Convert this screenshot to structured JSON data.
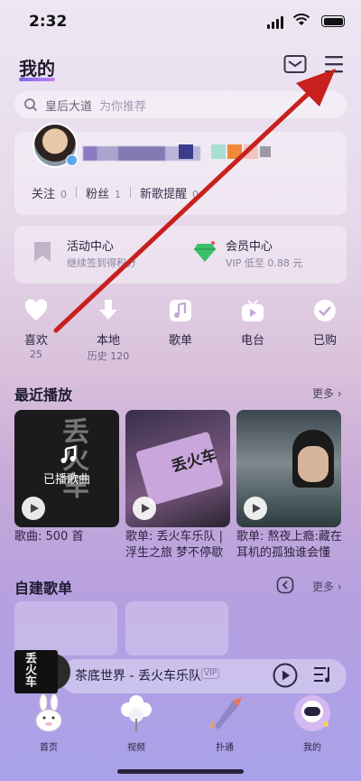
{
  "status": {
    "time": "2:32"
  },
  "header": {
    "title": "我的"
  },
  "search": {
    "query": "皇后大道",
    "hint": "为你推荐"
  },
  "profile": {
    "stats": [
      {
        "label": "关注",
        "value": "0"
      },
      {
        "label": "粉丝",
        "value": "1"
      },
      {
        "label": "新歌提醒",
        "value": "0"
      }
    ]
  },
  "activities": [
    {
      "title": "活动中心",
      "subtitle": "继续签到得积分"
    },
    {
      "title": "会员中心",
      "subtitle": "VIP 低至 0.88 元"
    }
  ],
  "quick": [
    {
      "label": "喜欢",
      "sub": "25",
      "icon": "heart-icon"
    },
    {
      "label": "本地",
      "sub": "历史 120",
      "icon": "download-icon"
    },
    {
      "label": "歌单",
      "sub": "",
      "icon": "music-note-icon"
    },
    {
      "label": "电台",
      "sub": "",
      "icon": "radio-icon"
    },
    {
      "label": "已购",
      "sub": "",
      "icon": "check-icon"
    }
  ],
  "recent": {
    "title": "最近播放",
    "more": "更多",
    "items": [
      {
        "caption": "歌曲: 500 首",
        "overlay": "已播歌曲",
        "cover_text": "丢火车"
      },
      {
        "caption": "歌单: 丢火车乐队 | 浮生之旅 梦不停歇",
        "cover_text": "丢火车"
      },
      {
        "caption": "歌单: 熬夜上瘾:藏在耳机的孤独谁会懂"
      }
    ]
  },
  "created": {
    "title": "自建歌单",
    "more": "更多"
  },
  "player": {
    "song": "茶底世界 - 丢火车乐队",
    "badge": "VIP",
    "cover_text": "丢火车"
  },
  "tabs": [
    {
      "label": "首页",
      "icon": "rabbit-icon"
    },
    {
      "label": "视频",
      "icon": "flower-icon"
    },
    {
      "label": "扑通",
      "icon": "rocket-icon"
    },
    {
      "label": "我的",
      "icon": "astronaut-icon"
    }
  ]
}
